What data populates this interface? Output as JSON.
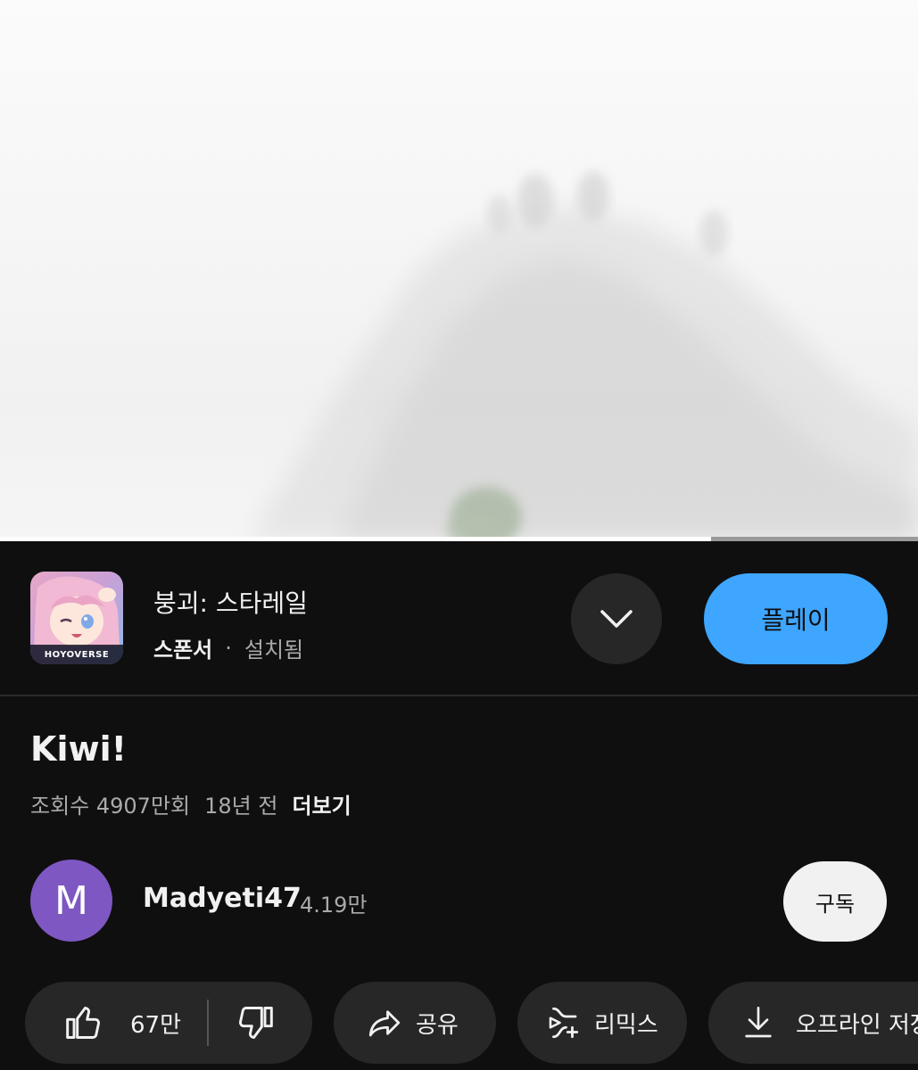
{
  "video": {
    "progress_fraction": 0.775
  },
  "ad": {
    "app_title": "붕괴: 스타레일",
    "app_logo_text": "HOYOVERSE",
    "sponsor_label": "스폰서",
    "separator": "·",
    "status": "설치됨",
    "expand_icon": "chevron-down-icon",
    "play_label": "플레이",
    "play_color": "#3ea6ff"
  },
  "video_info": {
    "title": "Kiwi!",
    "views": "조회수 4907만회",
    "age": "18년 전",
    "more_label": "더보기"
  },
  "channel": {
    "avatar_letter": "M",
    "avatar_color": "#7e57c2",
    "name": "Madyeti47",
    "subscribers": "4.19만",
    "subscribe_label": "구독"
  },
  "actions": {
    "like_count": "67만",
    "like_icon": "thumbs-up-icon",
    "dislike_icon": "thumbs-down-icon",
    "share_label": "공유",
    "share_icon": "share-icon",
    "remix_label": "리믹스",
    "remix_icon": "remix-icon",
    "offline_label": "오프라인 저장",
    "offline_icon": "download-icon"
  }
}
